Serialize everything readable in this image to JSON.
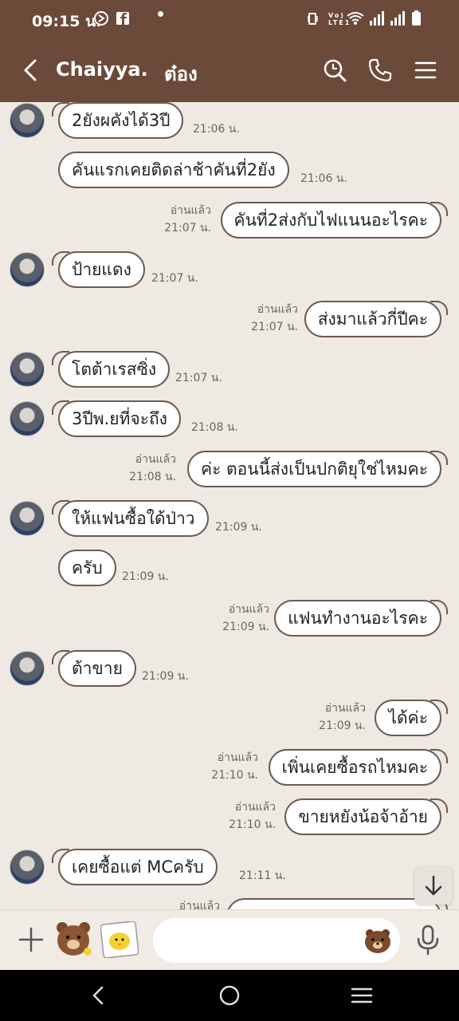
{
  "status_bar": {
    "time": "09:15 น.",
    "right_text": "Vo) LTE1"
  },
  "header": {
    "name_primary": "Chaiyya.",
    "name_secondary": "ต๋อง"
  },
  "messages": [
    {
      "dir": "in",
      "avatar": true,
      "text": "2ยังผคังได้3ปี",
      "time": "21:06 น.",
      "read": ""
    },
    {
      "dir": "in",
      "avatar": false,
      "text": "คันแรกเคยติดล่าช้าคันที่2ยัง",
      "time": "21:06 น.",
      "read": ""
    },
    {
      "dir": "out",
      "text": "คันที่2ส่งกับไฟแนนอะไรคะ",
      "time": "21:07 น.",
      "read": "อ่านแล้ว"
    },
    {
      "dir": "in",
      "avatar": true,
      "text": "ป้ายแดง",
      "time": "21:07 น.",
      "read": ""
    },
    {
      "dir": "out",
      "text": "ส่งมาแล้วกี่ปีคะ",
      "time": "21:07 น.",
      "read": "อ่านแล้ว"
    },
    {
      "dir": "in",
      "avatar": true,
      "text": "โตต้าเรสซิ่ง",
      "time": "21:07 น.",
      "read": ""
    },
    {
      "dir": "in",
      "avatar": true,
      "text": "3ปีพ.ยที่จะถึง",
      "time": "21:08 น.",
      "read": ""
    },
    {
      "dir": "out",
      "text": "ค่ะ ตอนนี้ส่งเป็นปกติยุใช่ไหมคะ",
      "time": "21:08 น.",
      "read": "อ่านแล้ว"
    },
    {
      "dir": "in",
      "avatar": true,
      "text": "ให้แฟนซื้อใด้ป่าว",
      "time": "21:09 น.",
      "read": ""
    },
    {
      "dir": "in",
      "avatar": false,
      "text": "ครับ",
      "time": "21:09 น.",
      "read": ""
    },
    {
      "dir": "out",
      "text": "แฟนทำงานอะไรคะ",
      "time": "21:09 น.",
      "read": "อ่านแล้ว"
    },
    {
      "dir": "in",
      "avatar": true,
      "text": "ต้าขาย",
      "time": "21:09 น.",
      "read": ""
    },
    {
      "dir": "out",
      "text": "ได้ค่ะ",
      "time": "21:09 น.",
      "read": "อ่านแล้ว"
    },
    {
      "dir": "out",
      "text": "เพิ่นเคยซื้อรถไหมคะ",
      "time": "21:10 น.",
      "read": "อ่านแล้ว"
    },
    {
      "dir": "out",
      "text": "ขายหยังน้อจ้าอ้าย",
      "time": "21:10 น.",
      "read": "อ่านแล้ว"
    },
    {
      "dir": "in",
      "avatar": true,
      "text": "เคยซื้อแต่  MCครับ",
      "time": "21:11 น.",
      "read": ""
    },
    {
      "dir": "out",
      "text": "",
      "time": "",
      "read": "อ่านแล้ว"
    }
  ],
  "input": {
    "placeholder": ""
  },
  "colors": {
    "header_bg": "#6b4a3a",
    "chat_bg": "#efe9e3",
    "bubble_border": "#6d5a50"
  }
}
